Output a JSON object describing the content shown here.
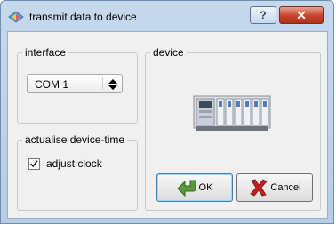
{
  "window": {
    "title": "transmit data to device",
    "help_glyph": "?",
    "close_glyph": "✕",
    "icon": "transmit-data-icon"
  },
  "interface_group": {
    "legend": "interface",
    "port_value": "COM 1"
  },
  "time_group": {
    "legend": "actualise device-time",
    "adjust_clock_label": "adjust clock",
    "adjust_clock_checked": true
  },
  "device_group": {
    "legend": "device",
    "image": "device-rack-image"
  },
  "buttons": {
    "ok_label": "OK",
    "cancel_label": "Cancel"
  },
  "colors": {
    "titlebar": "#c6d8ec",
    "close_button": "#c4432a",
    "dialog_background": "#f0f0f0",
    "ok_icon_green": "#5a9a3a",
    "cancel_icon_red": "#c02020"
  }
}
